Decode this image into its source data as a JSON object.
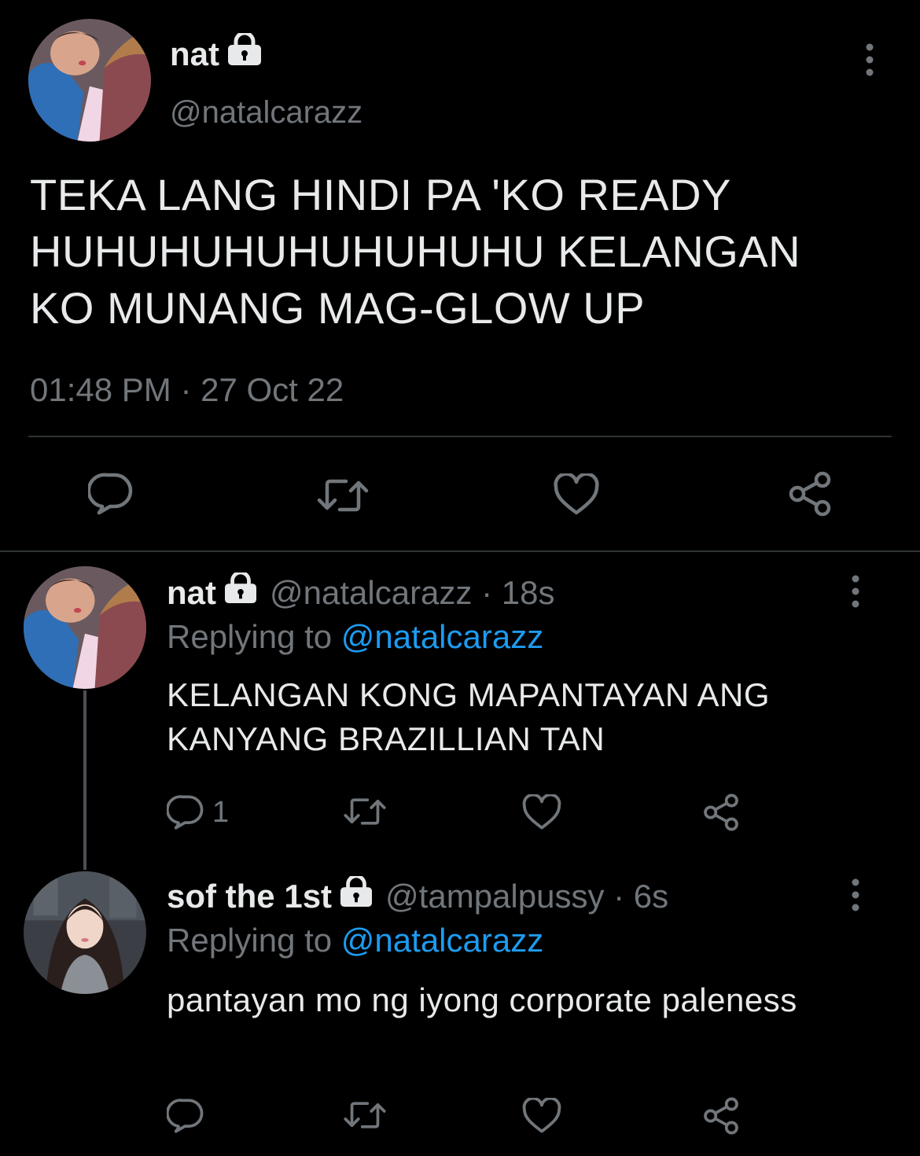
{
  "main_tweet": {
    "display_name": "nat",
    "handle": "@natalcarazz",
    "text": "TEKA LANG HINDI PA 'KO READY\nHUHUHUHUHUHUHUHU KELANGAN\nKO MUNANG MAG-GLOW UP",
    "time": "01:48 PM · 27 Oct 22",
    "avatar": "profile-photo",
    "icons": {
      "lock": "lock-icon",
      "more": "more-vertical-icon",
      "reply": "reply-icon",
      "retweet": "retweet-icon",
      "like": "heart-icon",
      "share": "share-icon"
    }
  },
  "replies": [
    {
      "display_name": "nat",
      "meta": "@natalcarazz · 18s",
      "replying_prefix": "Replying to",
      "replying_to": "@natalcarazz",
      "text": "KELANGAN KONG MAPANTAYAN ANG KANYANG BRAZILLIAN TAN",
      "reply_count": "1"
    },
    {
      "display_name": "sof the 1st",
      "meta": "@tampalpussy · 6s",
      "replying_prefix": "Replying to",
      "replying_to": "@natalcarazz",
      "text": "pantayan mo ng iyong corporate paleness",
      "reply_count": ""
    }
  ],
  "colors": {
    "background": "#000000",
    "text": "#e7e9ea",
    "secondary": "#71767b",
    "accent": "#1d9bf0",
    "divider": "#2f3336"
  }
}
